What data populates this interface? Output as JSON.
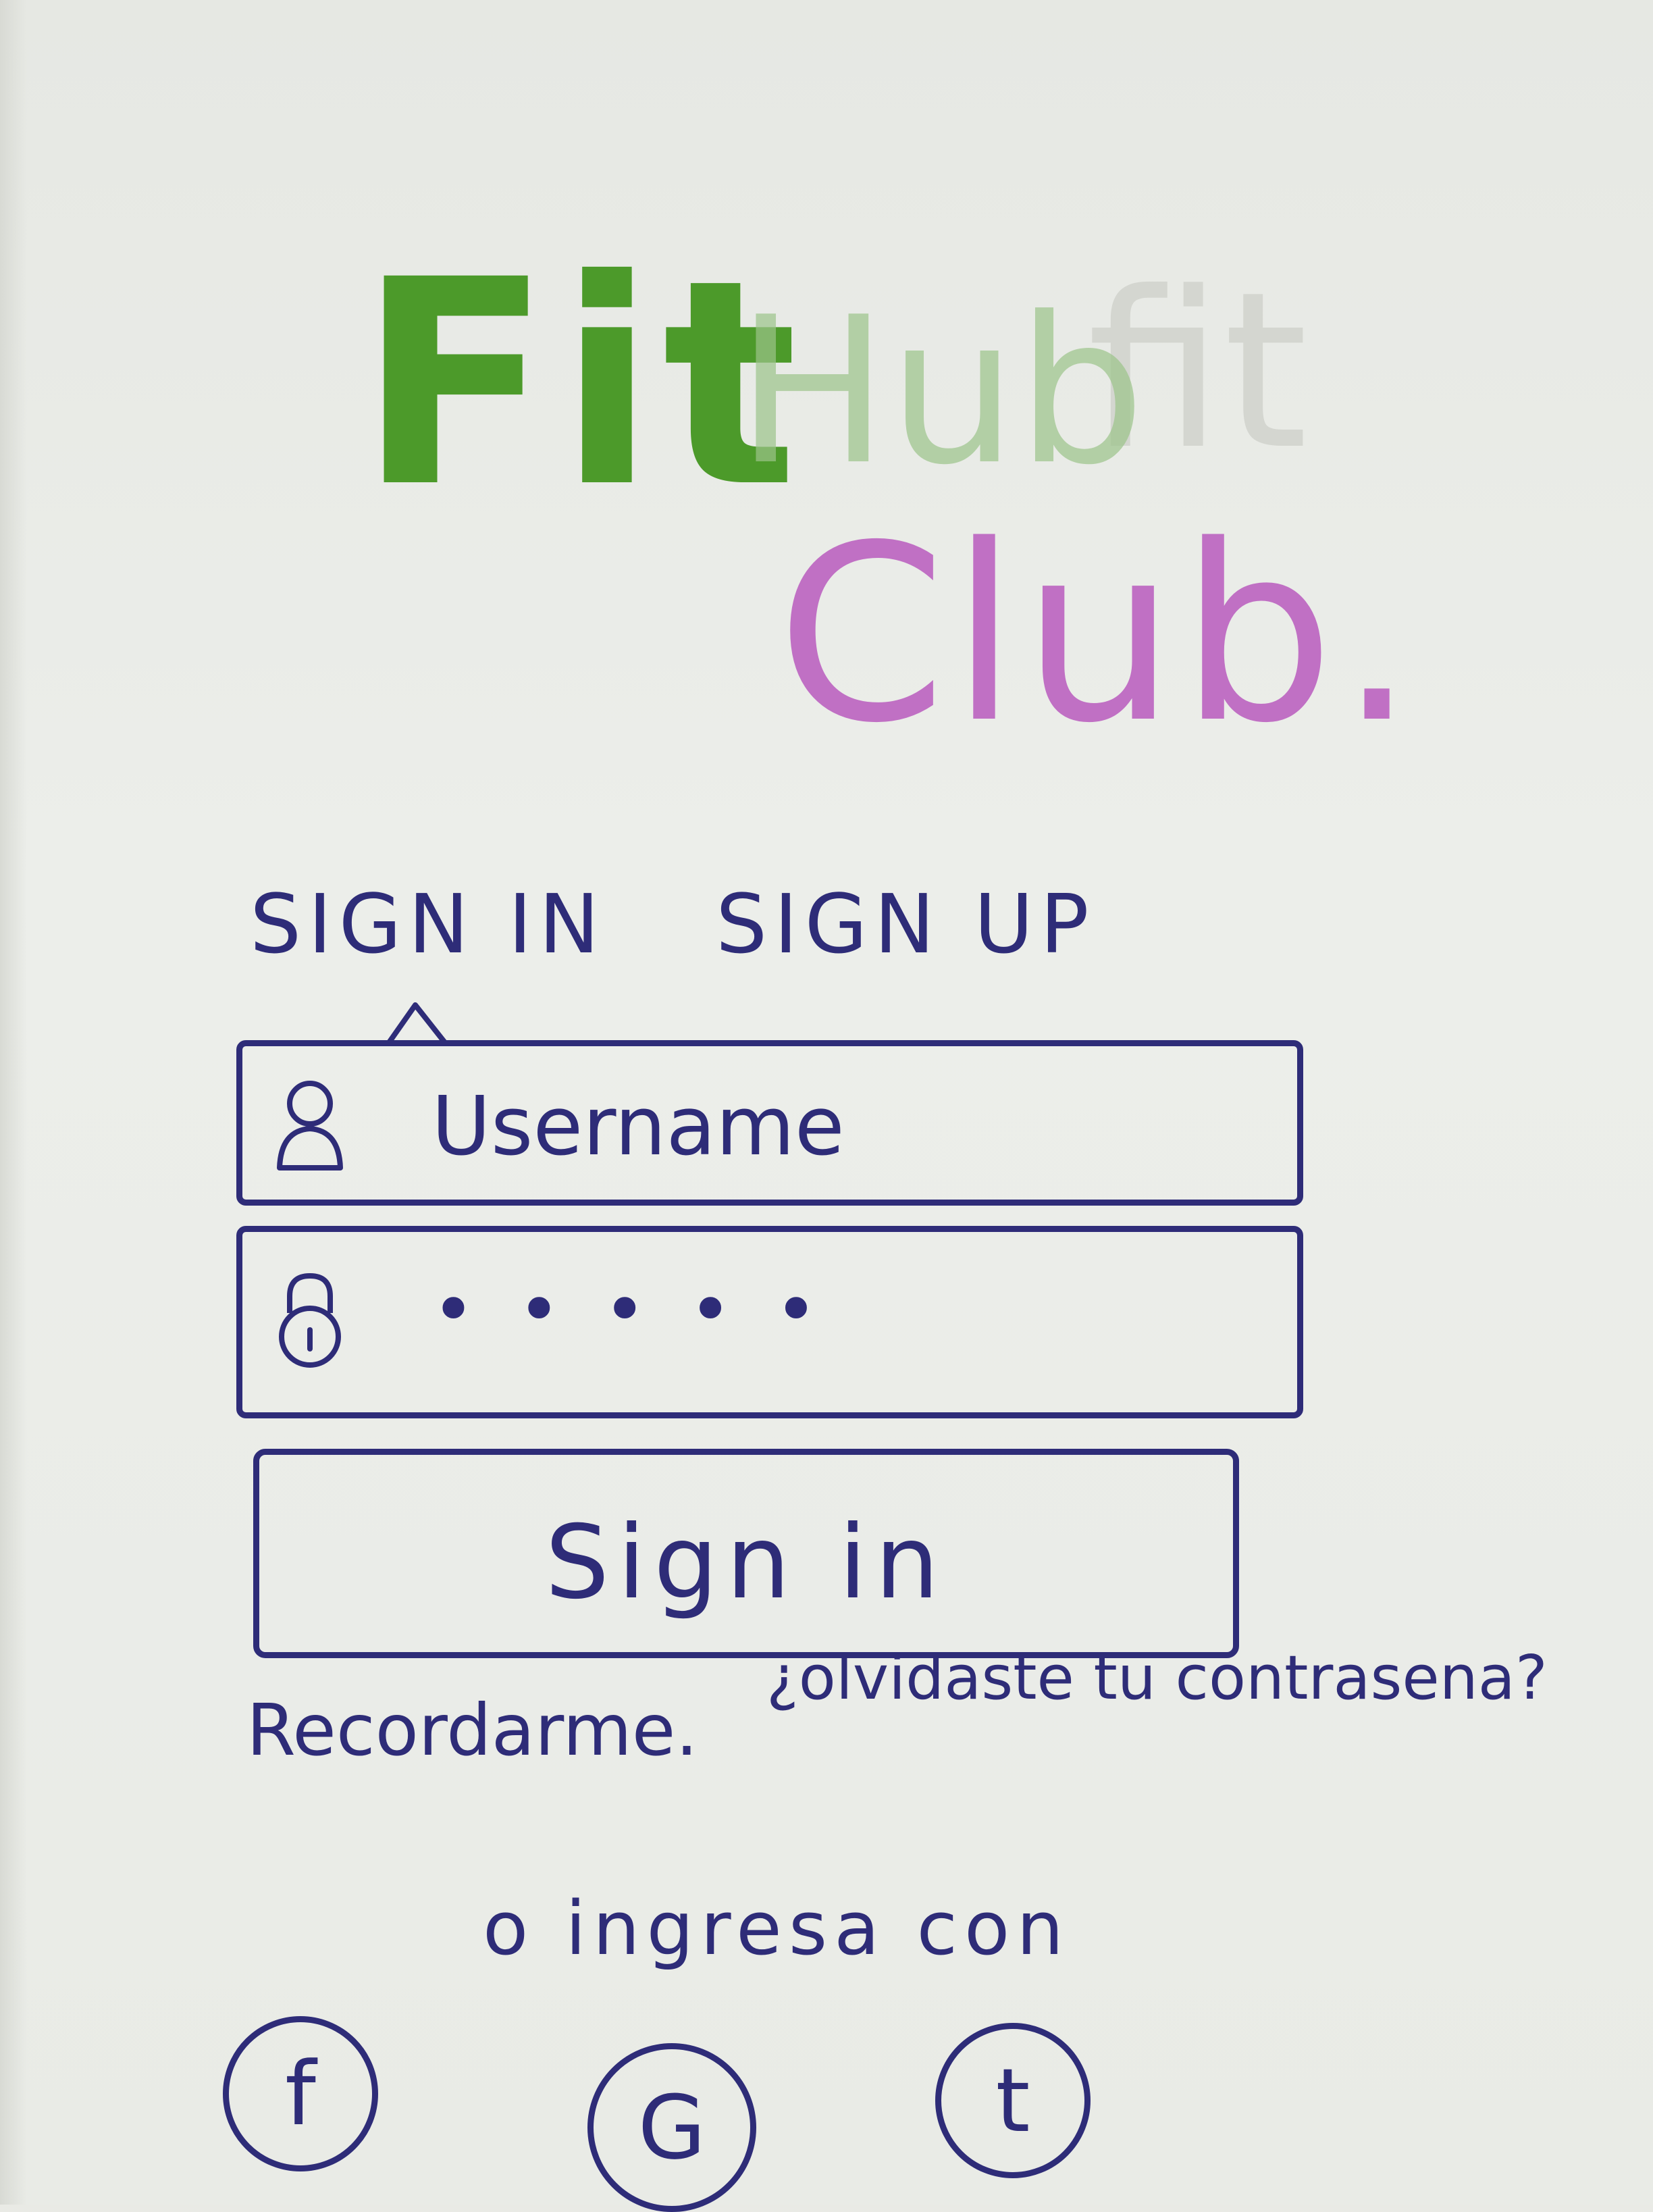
{
  "logo": {
    "fit": "Fit",
    "hub": "Hub",
    "ghost": "fit",
    "club": "Club."
  },
  "tabs": {
    "signin": "SIGN IN",
    "signup": "SIGN UP"
  },
  "form": {
    "username_placeholder": "Username",
    "password_value": "•••••",
    "signin_label": "Sign in",
    "remember_label": "Recordarme.",
    "forgot_label": "¿olvidaste tu contrasena?"
  },
  "social": {
    "heading": "o ingresa con",
    "facebook": "f",
    "google": "G",
    "twitter": "t"
  },
  "colors": {
    "ink": "#2e2c78",
    "logo_green": "#4c9a2a",
    "logo_purple": "#c070c4"
  },
  "icons": {
    "username": "user-icon",
    "password": "lock-icon",
    "facebook": "facebook-icon",
    "google": "google-icon",
    "twitter": "twitter-icon"
  }
}
